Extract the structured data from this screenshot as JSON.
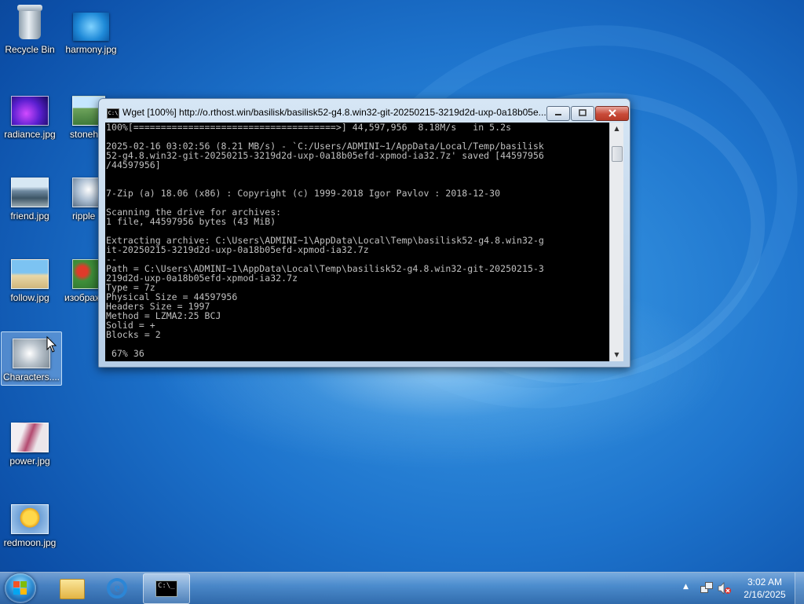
{
  "desktop": {
    "icons": [
      {
        "label": "Recycle Bin"
      },
      {
        "label": "harmony.jpg"
      },
      {
        "label": "radiance.jpg"
      },
      {
        "label": "stoneh"
      },
      {
        "label": "friend.jpg"
      },
      {
        "label": "ripple"
      },
      {
        "label": "follow.jpg"
      },
      {
        "label": "изображ"
      },
      {
        "label": "Characters...."
      },
      {
        "label": "power.jpg"
      },
      {
        "label": "redmoon.jpg"
      }
    ]
  },
  "window": {
    "title": "Wget [100%] http://o.rthost.win/basilisk/basilisk52-g4.8.win32-git-20250215-3219d2d-uxp-0a18b05e...",
    "app_icon_text": "C:\\",
    "console_lines": [
      "100%[=====================================>] 44,597,956  8.18M/s   in 5.2s",
      "",
      "2025-02-16 03:02:56 (8.21 MB/s) - `C:/Users/ADMINI~1/AppData/Local/Temp/basilisk",
      "52-g4.8.win32-git-20250215-3219d2d-uxp-0a18b05efd-xpmod-ia32.7z' saved [44597956",
      "/44597956]",
      "",
      "",
      "7-Zip (a) 18.06 (x86) : Copyright (c) 1999-2018 Igor Pavlov : 2018-12-30",
      "",
      "Scanning the drive for archives:",
      "1 file, 44597956 bytes (43 MiB)",
      "",
      "Extracting archive: C:\\Users\\ADMINI~1\\AppData\\Local\\Temp\\basilisk52-g4.8.win32-g",
      "it-20250215-3219d2d-uxp-0a18b05efd-xpmod-ia32.7z",
      "--",
      "Path = C:\\Users\\ADMINI~1\\AppData\\Local\\Temp\\basilisk52-g4.8.win32-git-20250215-3",
      "219d2d-uxp-0a18b05efd-xpmod-ia32.7z",
      "Type = 7z",
      "Physical Size = 44597956",
      "Headers Size = 1997",
      "Method = LZMA2:25 BCJ",
      "Solid = +",
      "Blocks = 2",
      "",
      " 67% 36"
    ]
  },
  "taskbar": {
    "clock_time": "3:02 AM",
    "clock_date": "2/16/2025",
    "cmd_icon_text": "C:\\_"
  },
  "colors": {
    "console_bg": "#000000",
    "console_fg": "#c0c0c0",
    "desktop_blue": "#1d73cc"
  }
}
